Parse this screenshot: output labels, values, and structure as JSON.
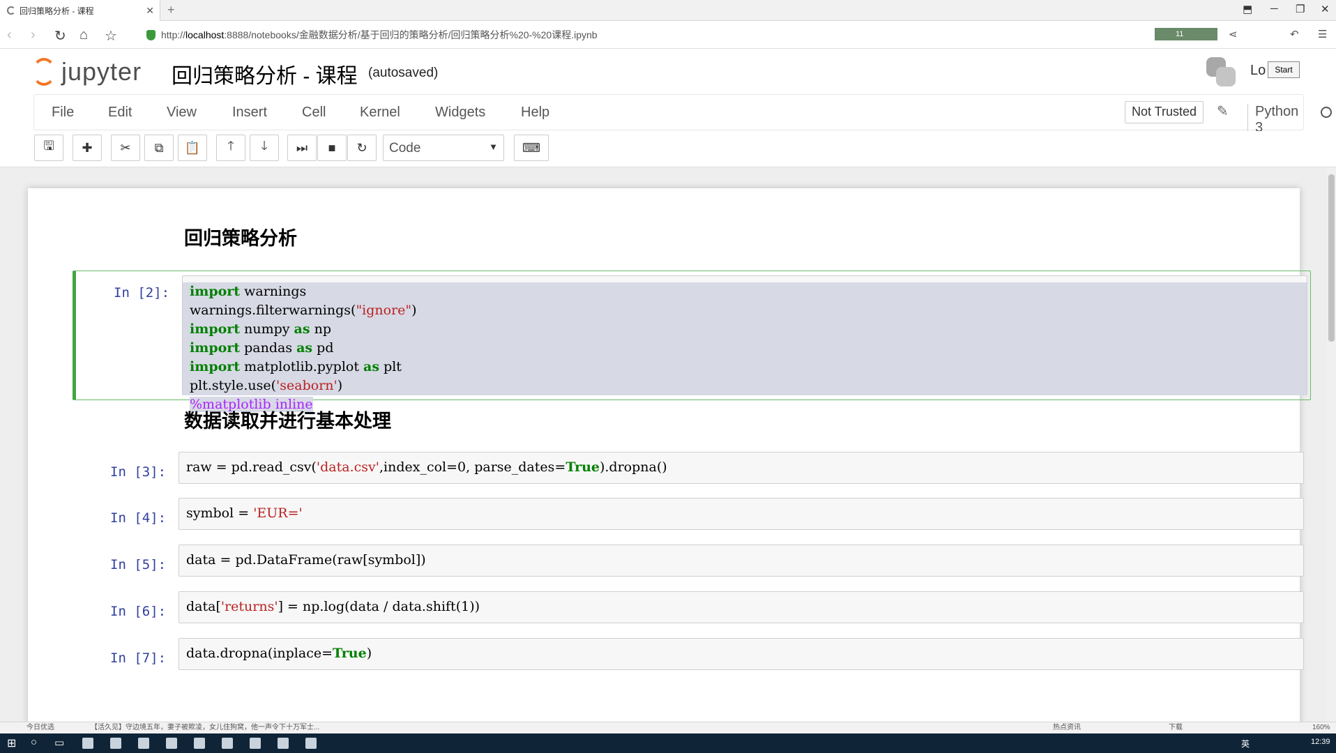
{
  "browser": {
    "tab_title": "回归策略分析 - 课程",
    "url_scheme": "http://",
    "url_host": "localhost",
    "url_path": ":8888/notebooks/金融数据分析/基于回归的策略分析/回归策略分析%20-%20课程.ipynb",
    "ext_badge": "11"
  },
  "jupyter": {
    "logo_text": "jupyter",
    "notebook_title": "回归策略分析 - 课程",
    "autosaved": "(autosaved)",
    "logout_partial": "Lo",
    "start_label": "Start"
  },
  "menu": {
    "items": [
      "File",
      "Edit",
      "View",
      "Insert",
      "Cell",
      "Kernel",
      "Widgets",
      "Help"
    ],
    "not_trusted": "Not Trusted",
    "kernel": "Python 3"
  },
  "toolbar": {
    "cell_type": "Code"
  },
  "notebook": {
    "heading1": "回归策略分析",
    "heading2": "数据读取并进行基本处理",
    "cells": [
      {
        "prompt": "In  [2]:"
      },
      {
        "prompt": "In  [3]:"
      },
      {
        "prompt": "In  [4]:"
      },
      {
        "prompt": "In  [5]:"
      },
      {
        "prompt": "In  [6]:"
      },
      {
        "prompt": "In  [7]:"
      }
    ],
    "code": {
      "c2_l1_kw": "import",
      "c2_l1_rest": " warnings",
      "c2_l2_a": "warnings.filterwarnings(",
      "c2_l2_str": "\"ignore\"",
      "c2_l2_b": ")",
      "c2_l3_kw": "import",
      "c2_l3_rest": " numpy ",
      "c2_l3_as": "as",
      "c2_l3_np": " np",
      "c2_l4_kw": "import",
      "c2_l4_rest": " pandas ",
      "c2_l4_as": "as",
      "c2_l4_pd": " pd",
      "c2_l5_kw": "import",
      "c2_l5_rest": " matplotlib.pyplot ",
      "c2_l5_as": "as",
      "c2_l5_plt": " plt",
      "c2_l6_a": "plt.style.use(",
      "c2_l6_str": "'seaborn'",
      "c2_l6_b": ")",
      "c2_l7_magic": "%matplotlib inline",
      "c3_a": "raw = pd.read_csv(",
      "c3_str": "'data.csv'",
      "c3_b": ",index_col=0, parse_dates=",
      "c3_true": "True",
      "c3_c": ").dropna()",
      "c4_a": "symbol = ",
      "c4_str": "'EUR='",
      "c5": "data = pd.DataFrame(raw[symbol])",
      "c6_a": "data[",
      "c6_str": "'returns'",
      "c6_b": "] = np.log(data / data.shift(1))",
      "c7_a": "data.dropna(inplace=",
      "c7_true": "True",
      "c7_b": ")"
    }
  },
  "statusbar": {
    "left": "今日优选",
    "news": "【活久见】守边境五年，妻子被欺凌，女儿住狗窝，他一声令下十万军士...",
    "hot": "热点资讯",
    "download": "下载",
    "zoom": "160%"
  },
  "taskbar": {
    "ime": "英",
    "time": "12:39"
  }
}
